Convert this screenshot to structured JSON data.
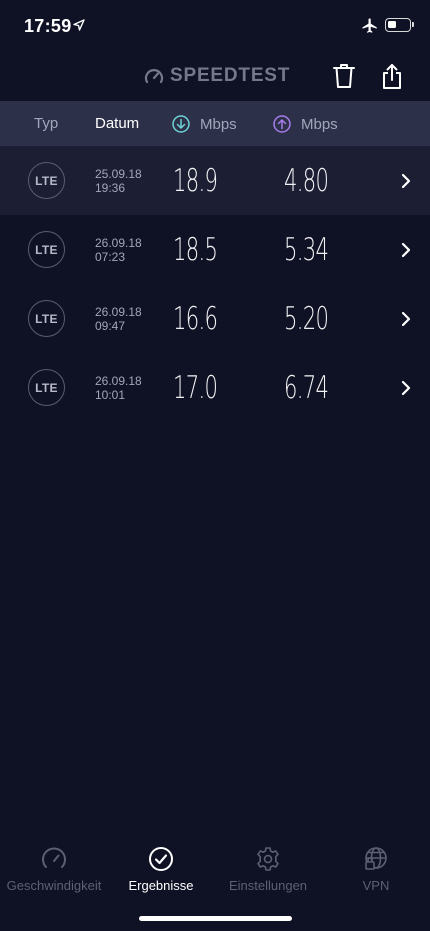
{
  "status": {
    "time": "17:59"
  },
  "header": {
    "logo_text": "SPEEDTEST"
  },
  "table_header": {
    "typ": "Typ",
    "datum": "Datum",
    "download_unit": "Mbps",
    "upload_unit": "Mbps"
  },
  "rows": [
    {
      "type": "LTE",
      "date": "25.09.18",
      "time": "19:36",
      "download": "18.9",
      "upload": "4.80"
    },
    {
      "type": "LTE",
      "date": "26.09.18",
      "time": "07:23",
      "download": "18.5",
      "upload": "5.34"
    },
    {
      "type": "LTE",
      "date": "26.09.18",
      "time": "09:47",
      "download": "16.6",
      "upload": "5.20"
    },
    {
      "type": "LTE",
      "date": "26.09.18",
      "time": "10:01",
      "download": "17.0",
      "upload": "6.74"
    }
  ],
  "tabs": [
    {
      "label": "Geschwindigkeit",
      "icon": "speedometer-icon",
      "active": false
    },
    {
      "label": "Ergebnisse",
      "icon": "checkmark-circle-icon",
      "active": true
    },
    {
      "label": "Einstellungen",
      "icon": "gear-icon",
      "active": false
    },
    {
      "label": "VPN",
      "icon": "globe-lock-icon",
      "active": false
    }
  ],
  "colors": {
    "background": "#0f1124",
    "header_bar": "#2c3049",
    "download_accent": "#6fd3d6",
    "upload_accent": "#a87ce8"
  }
}
